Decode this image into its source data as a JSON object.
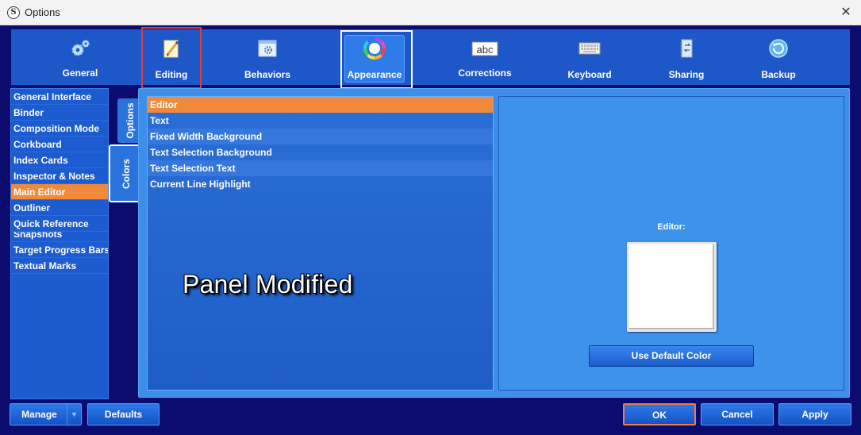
{
  "window": {
    "title": "Options"
  },
  "toolbar": {
    "items": [
      {
        "label": "General",
        "icon": "gears-icon"
      },
      {
        "label": "Editing",
        "icon": "pencil-notepad-icon"
      },
      {
        "label": "Behaviors",
        "icon": "window-gear-icon"
      },
      {
        "label": "Appearance",
        "icon": "color-wheel-icon"
      },
      {
        "label": "Corrections",
        "icon": "abc-icon"
      },
      {
        "label": "Keyboard",
        "icon": "keyboard-icon"
      },
      {
        "label": "Sharing",
        "icon": "notebook-arrows-icon"
      },
      {
        "label": "Backup",
        "icon": "backup-circle-icon"
      }
    ],
    "selected": "Appearance"
  },
  "sidebar": {
    "items": [
      "General Interface",
      "Binder",
      "Composition Mode",
      "Corkboard",
      "Index Cards",
      "Inspector & Notes",
      "Main Editor",
      "Outliner",
      "Quick Reference",
      "Snapshots",
      "Target Progress Bars",
      "Textual Marks"
    ],
    "selected": "Main Editor"
  },
  "tabs": {
    "options": "Options",
    "colors": "Colors",
    "active": "Colors"
  },
  "colors_list": {
    "items": [
      "Editor",
      "Text",
      "Fixed Width Background",
      "Text Selection Background",
      "Text Selection Text",
      "Current Line Highlight"
    ],
    "selected": "Editor"
  },
  "preview": {
    "label": "Editor:",
    "swatch_color": "#ffffff",
    "default_button": "Use Default Color"
  },
  "overlay_text": "Panel Modified",
  "footer": {
    "manage": "Manage",
    "defaults": "Defaults",
    "ok": "OK",
    "cancel": "Cancel",
    "apply": "Apply"
  },
  "colors": {
    "accent_selected": "#f08a3a",
    "window_bg": "#0c0c6e",
    "toolbar_bg": "#1e57c8"
  }
}
